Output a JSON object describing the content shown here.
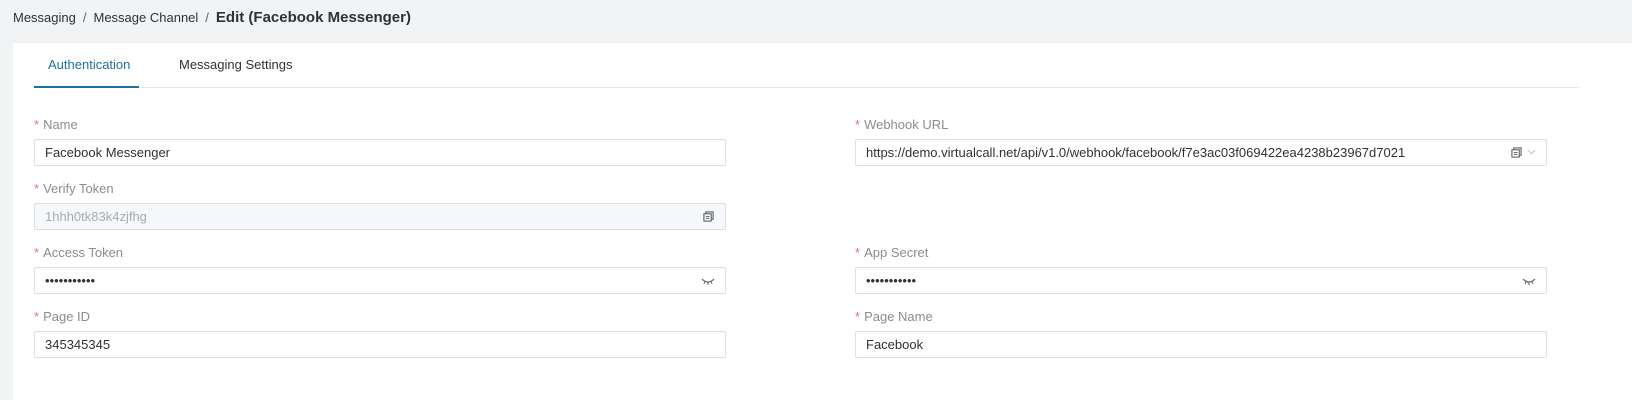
{
  "breadcrumb": {
    "items": [
      "Messaging",
      "Message Channel"
    ],
    "separator": "/",
    "current": "Edit (Facebook Messenger)"
  },
  "tabs": [
    {
      "label": "Authentication",
      "active": true
    },
    {
      "label": "Messaging Settings",
      "active": false
    }
  ],
  "form": {
    "required_mark": "*",
    "name": {
      "label": "Name",
      "value": "Facebook Messenger"
    },
    "webhook_url": {
      "label": "Webhook URL",
      "value": "https://demo.virtualcall.net/api/v1.0/webhook/facebook/f7e3ac03f069422ea4238b23967d7021"
    },
    "verify_token": {
      "label": "Verify Token",
      "value": "1hhh0tk83k4zjfhg"
    },
    "access_token": {
      "label": "Access Token",
      "value": "•••••••••••"
    },
    "app_secret": {
      "label": "App Secret",
      "value": "•••••••••••"
    },
    "page_id": {
      "label": "Page ID",
      "value": "345345345"
    },
    "page_name": {
      "label": "Page Name",
      "value": "Facebook"
    }
  },
  "colors": {
    "accent": "#1f6fa3",
    "required": "#f56c6c",
    "page_bg": "#f2f3f5"
  },
  "icons": {
    "copy": "copy-icon",
    "eye_closed": "eye-closed-icon",
    "chevron": "chevron-down-icon"
  }
}
